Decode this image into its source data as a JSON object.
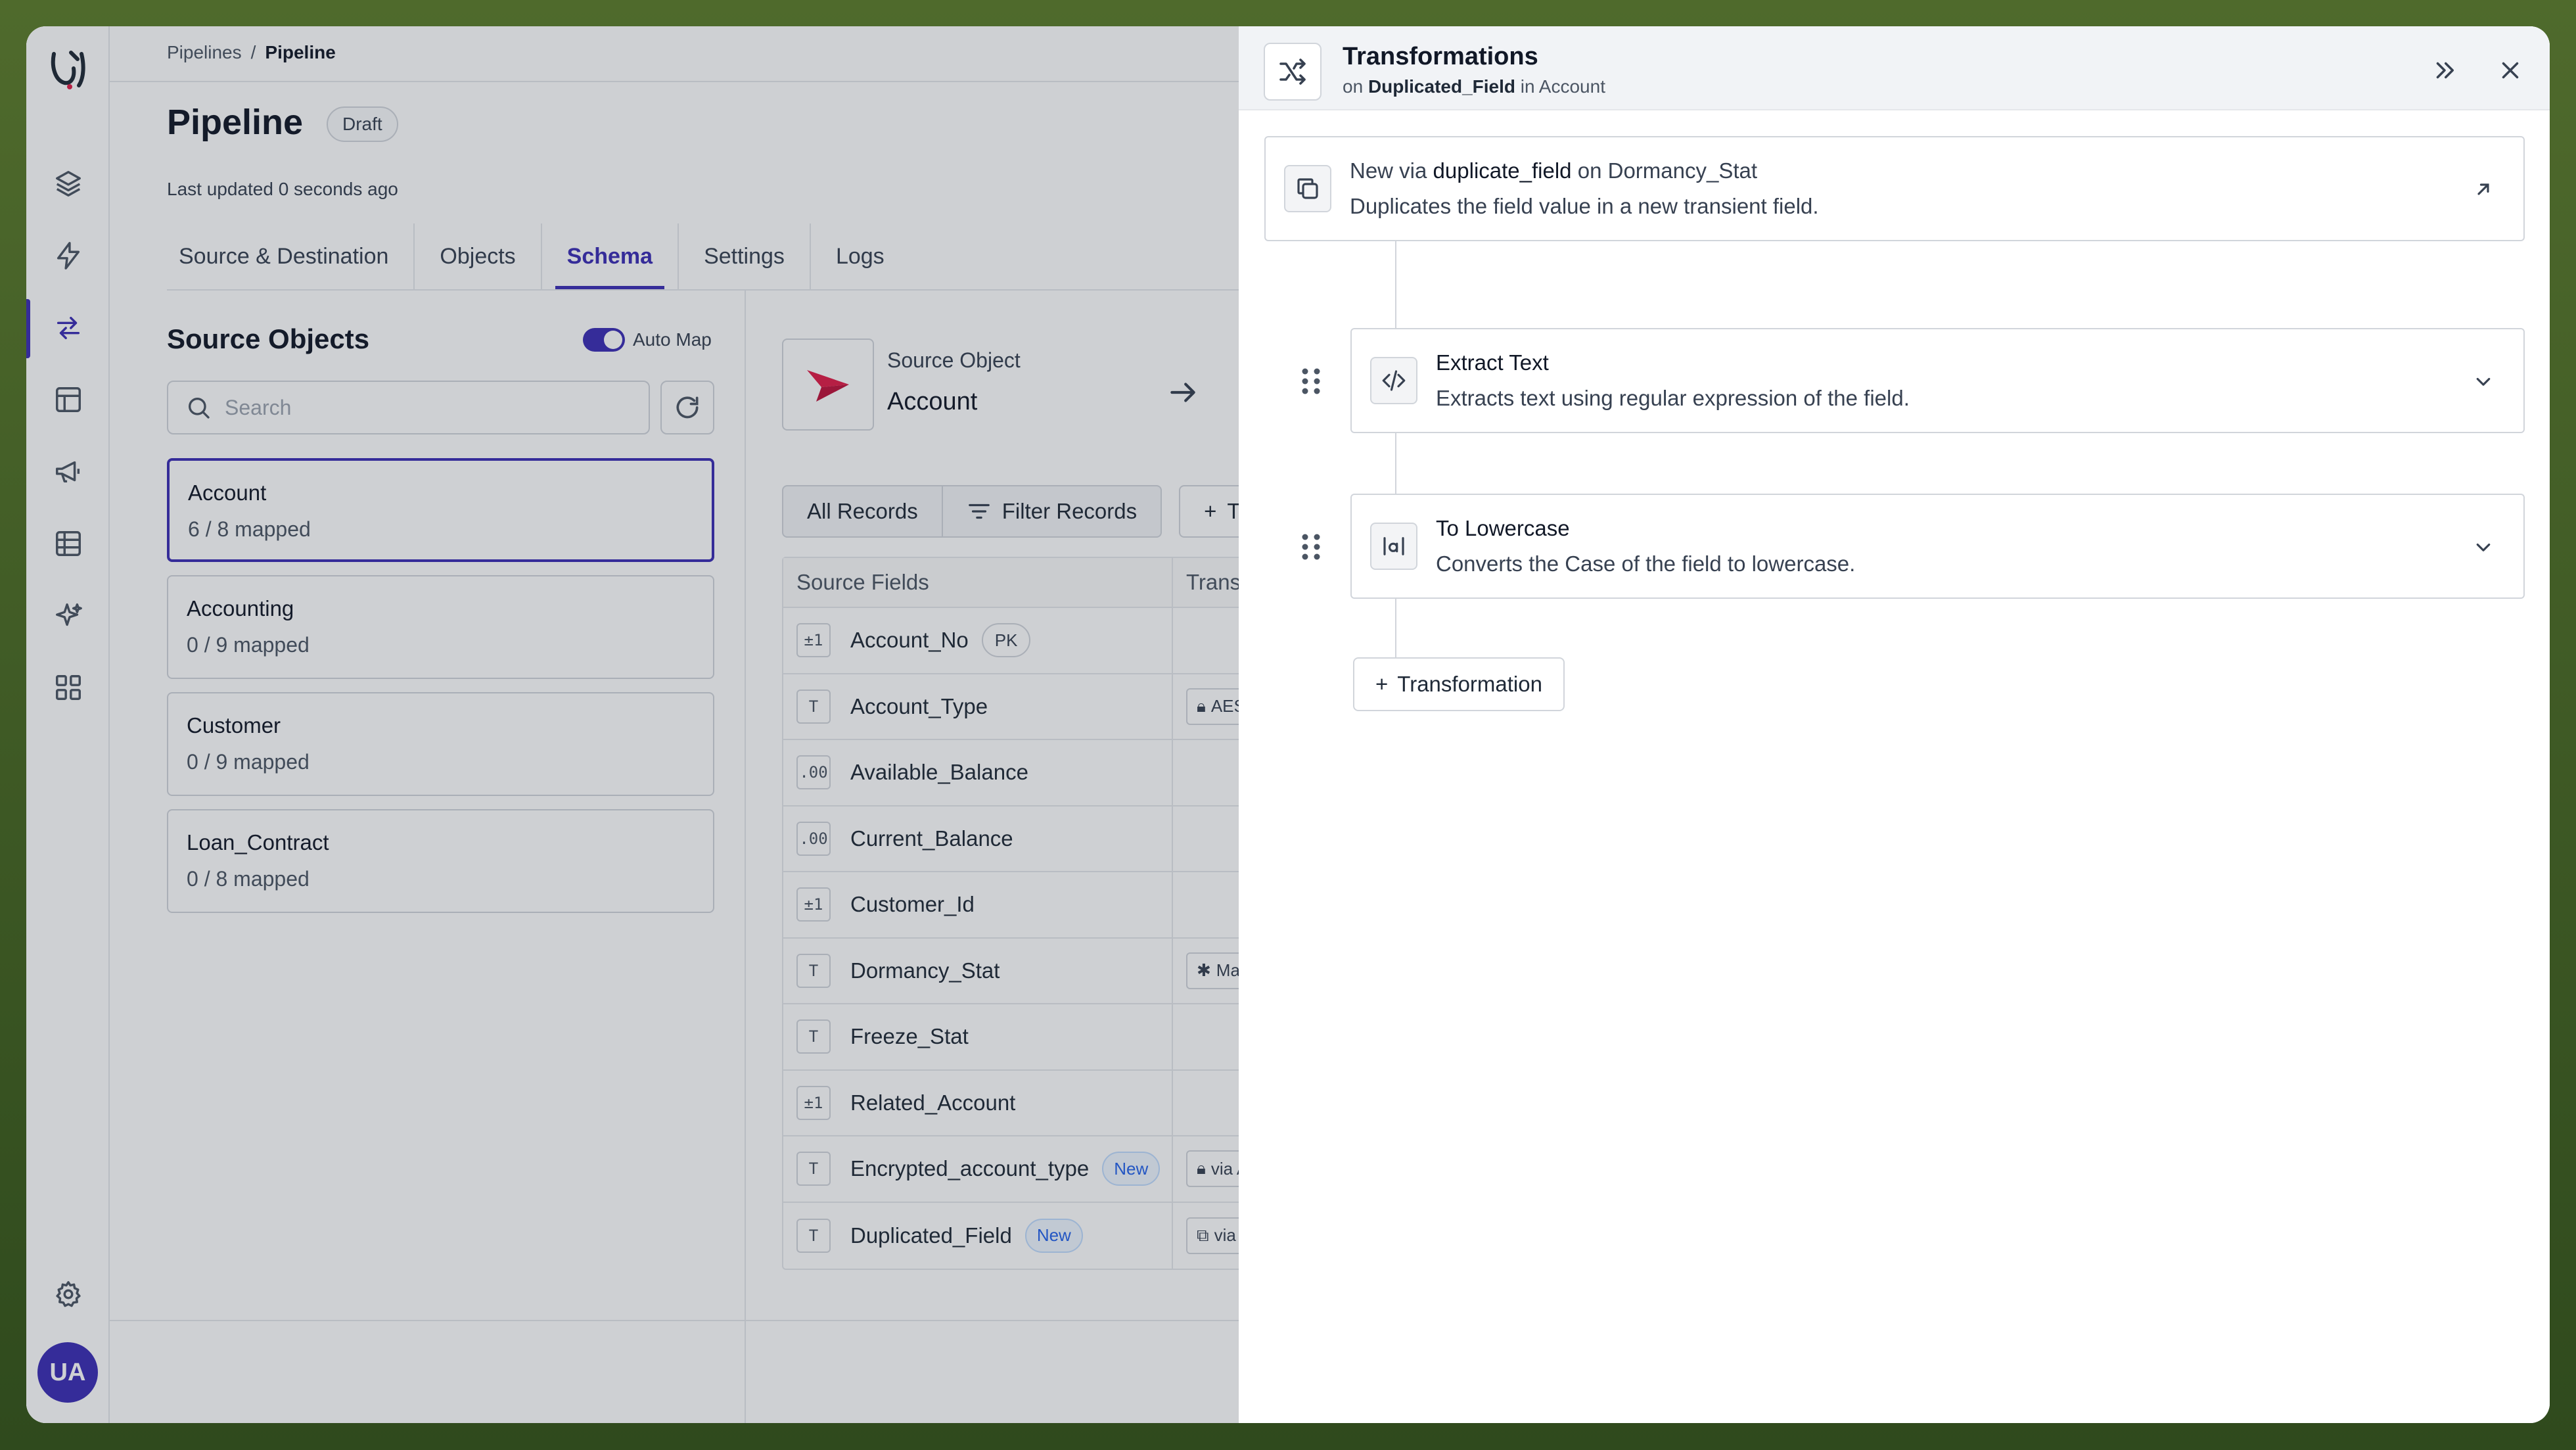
{
  "breadcrumbs": [
    "Pipelines",
    "/",
    "Pipeline"
  ],
  "page": {
    "title": "Pipeline",
    "status": "Draft",
    "updated": "Last updated 0 seconds ago"
  },
  "tabs": [
    {
      "label": "Source & Destination"
    },
    {
      "label": "Objects"
    },
    {
      "label": "Schema",
      "active": true
    },
    {
      "label": "Settings"
    },
    {
      "label": "Logs"
    }
  ],
  "source_objects": {
    "title": "Source Objects",
    "automap_label": "Auto Map",
    "search_placeholder": "Search",
    "items": [
      {
        "name": "Account",
        "mapped": "6 / 8 mapped",
        "selected": true
      },
      {
        "name": "Accounting",
        "mapped": "0 / 9 mapped"
      },
      {
        "name": "Customer",
        "mapped": "0 / 9 mapped"
      },
      {
        "name": "Loan_Contract",
        "mapped": "0 / 8 mapped"
      }
    ]
  },
  "mapping": {
    "source_label": "Source Object",
    "source_value": "Account",
    "all_records": "All Records",
    "filter_records": "Filter Records",
    "add_partial": "Tr",
    "col_source": "Source Fields",
    "col_transform": "Transfor",
    "fields": [
      {
        "type": "±1",
        "name": "Account_No",
        "tag": "PK",
        "transform": ""
      },
      {
        "type": "T",
        "name": "Account_Type",
        "tag": "",
        "transform": "AES E"
      },
      {
        "type": ".00",
        "name": "Available_Balance",
        "tag": "",
        "transform": ""
      },
      {
        "type": ".00",
        "name": "Current_Balance",
        "tag": "",
        "transform": ""
      },
      {
        "type": "±1",
        "name": "Customer_Id",
        "tag": "",
        "transform": ""
      },
      {
        "type": "T",
        "name": "Dormancy_Stat",
        "tag": "",
        "transform": "Mask"
      },
      {
        "type": "T",
        "name": "Freeze_Stat",
        "tag": "",
        "transform": ""
      },
      {
        "type": "±1",
        "name": "Related_Account",
        "tag": "",
        "transform": ""
      },
      {
        "type": "T",
        "name": "Encrypted_account_type",
        "tag": "New",
        "transform": "via Al"
      },
      {
        "type": "T",
        "name": "Duplicated_Field",
        "tag": "New",
        "transform": "via D"
      }
    ]
  },
  "drawer": {
    "title": "Transformations",
    "sub_prefix": "on",
    "sub_field": "Duplicated_Field",
    "sub_in": "in",
    "sub_object": "Account",
    "cards": [
      {
        "title_pre": "New via",
        "title_strong": "duplicate_field",
        "title_mid": "on",
        "title_post": "Dormancy_Stat",
        "desc": "Duplicates the field value in a new transient field."
      },
      {
        "title": "Extract Text",
        "desc": "Extracts text using regular expression of the field."
      },
      {
        "title": "To Lowercase",
        "desc": "Converts the Case of the field to lowercase."
      }
    ],
    "add_label": "Transformation"
  },
  "user": {
    "initials": "UA"
  },
  "colors": {
    "accent": "#3b2db5",
    "logo_red": "#e11d48"
  }
}
